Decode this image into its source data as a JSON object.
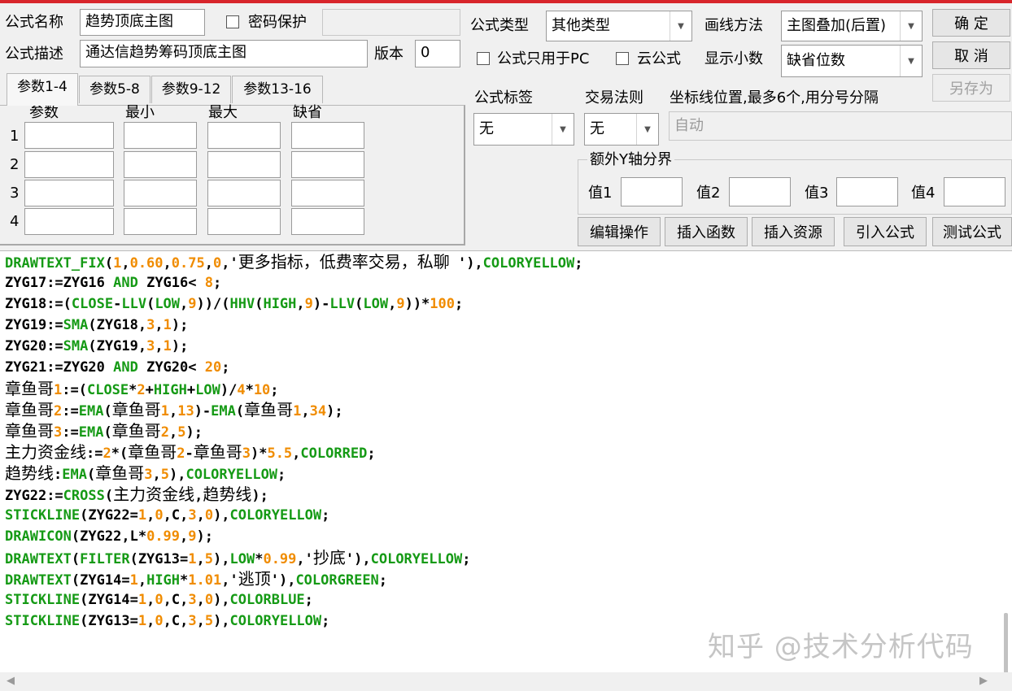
{
  "header": {
    "name_label": "公式名称",
    "name_value": "趋势顶底主图",
    "password_label": "密码保护",
    "password_checked": false,
    "desc_label": "公式描述",
    "desc_value": "通达信趋势筹码顶底主图",
    "version_label": "版本",
    "version_value": "0",
    "type_label": "公式类型",
    "type_value": "其他类型",
    "draw_label": "画线方法",
    "draw_value": "主图叠加(后置)",
    "pc_only_label": "公式只用于PC",
    "cloud_label": "云公式",
    "decimals_label": "显示小数",
    "decimals_value": "缺省位数"
  },
  "buttons": {
    "ok": "确 定",
    "cancel": "取 消",
    "save_as": "另存为"
  },
  "tabs": [
    {
      "label": "参数1-4",
      "active": true
    },
    {
      "label": "参数5-8",
      "active": false
    },
    {
      "label": "参数9-12",
      "active": false
    },
    {
      "label": "参数13-16",
      "active": false
    }
  ],
  "params": {
    "headers": [
      "参数",
      "最小",
      "最大",
      "缺省"
    ],
    "rows": [
      "1",
      "2",
      "3",
      "4"
    ]
  },
  "options": {
    "tag_label": "公式标签",
    "tag_value": "无",
    "rule_label": "交易法则",
    "rule_value": "无",
    "axis_label": "坐标线位置,最多6个,用分号分隔",
    "axis_value": "自动",
    "yaxis_group": "额外Y轴分界",
    "yaxis_values": [
      "值1",
      "值2",
      "值3",
      "值4"
    ]
  },
  "actions": [
    "编辑操作",
    "插入函数",
    "插入资源",
    "引入公式",
    "测试公式"
  ],
  "code_lines": [
    "DRAWTEXT_FIX(1,0.60,0.75,0,'更多指标，低费率交易，私聊 '),COLORYELLOW;",
    "ZYG17:=ZYG16 AND ZYG16< 8;",
    "ZYG18:=(CLOSE-LLV(LOW,9))/(HHV(HIGH,9)-LLV(LOW,9))*100;",
    "ZYG19:=SMA(ZYG18,3,1);",
    "ZYG20:=SMA(ZYG19,3,1);",
    "ZYG21:=ZYG20 AND ZYG20< 20;",
    "章鱼哥1:=(CLOSE*2+HIGH+LOW)/4*10;",
    "章鱼哥2:=EMA(章鱼哥1,13)-EMA(章鱼哥1,34);",
    "章鱼哥3:=EMA(章鱼哥2,5);",
    "主力资金线:=2*(章鱼哥2-章鱼哥3)*5.5,COLORRED;",
    "趋势线:EMA(章鱼哥3,5),COLORYELLOW;",
    "ZYG22:=CROSS(主力资金线,趋势线);",
    "STICKLINE(ZYG22=1,0,C,3,0),COLORYELLOW;",
    "DRAWICON(ZYG22,L*0.99,9);",
    "DRAWTEXT(FILTER(ZYG13=1,5),LOW*0.99,'抄底'),COLORYELLOW;",
    "DRAWTEXT(ZYG14=1,HIGH*1.01,'逃顶'),COLORGREEN;",
    "STICKLINE(ZYG14=1,0,C,3,0),COLORBLUE;",
    "STICKLINE(ZYG13=1,0,C,3,5),COLORYELLOW;"
  ],
  "watermark": "知乎 @技术分析代码",
  "colors": {
    "function": "#159a15",
    "number": "#f08c00",
    "text": "#000000",
    "title_bar_accent": "#d8252b"
  }
}
